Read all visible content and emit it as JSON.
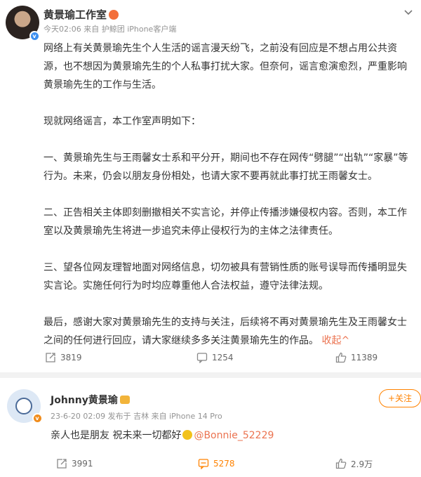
{
  "post": {
    "author": "黄景瑜工作室",
    "meta": "今天02:06  来自 护鲸团 iPhone客户端",
    "paragraphs": [
      "网络上有关黄景瑜先生个人生活的谣言漫天纷飞，之前没有回应是不想占用公共资源，也不想因为黄景瑜先生的个人私事打扰大家。但奈何，谣言愈演愈烈，严重影响黄景瑜先生的工作与生活。",
      "现就网络谣言，本工作室声明如下：",
      "一、黄景瑜先生与王雨馨女士系和平分开，期间也不存在网传“劈腿”“出轨”“家暴”等行为。未来，仍会以朋友身份相处，也请大家不要再就此事打扰王雨馨女士。",
      "二、正告相关主体即刻删撤相关不实言论，并停止传播涉嫌侵权内容。否则，本工作室以及黄景瑜先生将进一步追究未停止侵权行为的主体之法律责任。",
      "三、望各位网友理智地面对网络信息，切勿被具有营销性质的账号误导而传播明显失实言论。实施任何行为时均应尊重他人合法权益，遵守法律法规。",
      "最后，感谢大家对黄景瑜先生的支持与关注，后续将不再对黄景瑜先生及王雨馨女士之间的任何进行回应，请大家继续多多关注黄景瑜先生的作品。"
    ],
    "collapse_label": "收起^",
    "repost_count": "3819",
    "comment_count": "1254",
    "like_count": "11389"
  },
  "comment": {
    "author": "Johnny黄景瑜",
    "meta": "23-6-20 02:09  发布于 吉林  来自 iPhone 14 Pro",
    "follow_label": "+关注",
    "text": "亲人也是朋友 祝未来一切都好",
    "mention": "@Bonnie_52229",
    "repost_count": "3991",
    "comment_count": "5278",
    "like_count": "2.9万"
  },
  "icons": {
    "repost": "repost-icon",
    "comment": "comment-icon",
    "like": "thumbs-up-icon",
    "menu": "chevron-down-icon",
    "verified": "verified-badge-icon"
  },
  "colors": {
    "accent": "#eb7350",
    "follow": "#ff8200",
    "verified_blue": "#3c8ff0",
    "verified_orange": "#f08c1c",
    "meta_gray": "#939393"
  }
}
